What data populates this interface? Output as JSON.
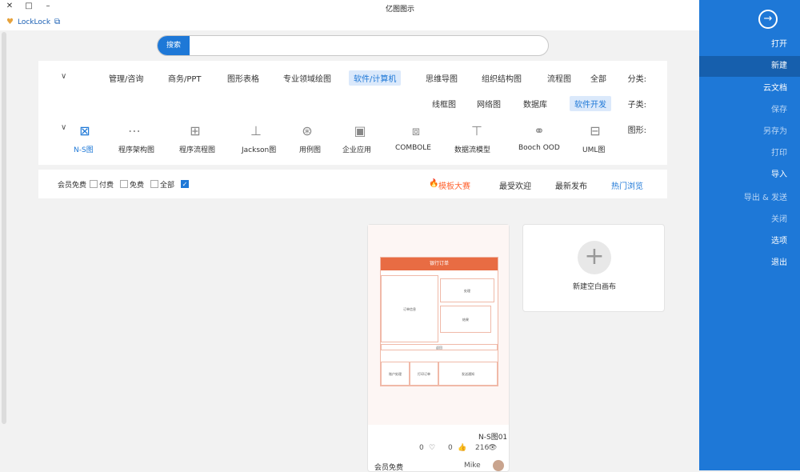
{
  "window": {
    "title": "亿图图示",
    "minimize": "–",
    "restore": "□",
    "close": "✕",
    "lock_label": "LockLock",
    "colors": {
      "accent": "#1e78d7",
      "hot": "#ff6633",
      "template": "#e86c43"
    }
  },
  "sidebar": {
    "items": [
      {
        "label": "打开"
      },
      {
        "label": "新建"
      },
      {
        "label": "云文档"
      },
      {
        "label": "保存"
      },
      {
        "label": "另存为"
      },
      {
        "label": "打印"
      },
      {
        "label": "导入"
      },
      {
        "label": "导出 & 发送"
      },
      {
        "label": "关闭"
      },
      {
        "label": "选项"
      },
      {
        "label": "退出"
      }
    ]
  },
  "search": {
    "button": "搜索",
    "placeholder": ""
  },
  "filters": {
    "category_label": "分类:",
    "categories": [
      "全部",
      "流程图",
      "组织结构图",
      "思维导图",
      "软件/计算机",
      "专业领域绘图",
      "图形表格",
      "商务/PPT",
      "管理/咨询"
    ],
    "subcategory_label": "子类:",
    "subcategories": [
      "软件开发",
      "数据库",
      "网络图",
      "线框图"
    ],
    "graphic_label": "图形:",
    "graphics": [
      "UML图",
      "Booch OOD",
      "数据流模型",
      "COMBOLE",
      "企业应用",
      "用例图",
      "Jackson图",
      "程序流程图",
      "程序架构图",
      "N-S图"
    ]
  },
  "sort": {
    "items": [
      "热门浏览",
      "最新发布",
      "最受欢迎",
      "模板大赛"
    ],
    "checks": [
      "全部",
      "免费",
      "付费",
      "会员免费"
    ]
  },
  "new_card": {
    "label": "新建空白画布",
    "plus": "+"
  },
  "template_card": {
    "header": "银行订单",
    "name": "N-S图01",
    "views": "216",
    "likes": "0",
    "favorites": "0",
    "author": "Mike",
    "member": "会员免费",
    "boxes": [
      "订单信息",
      "处理",
      "结果",
      "返回",
      "账户处理",
      "打印订单",
      "发送通知",
      "完成"
    ]
  }
}
